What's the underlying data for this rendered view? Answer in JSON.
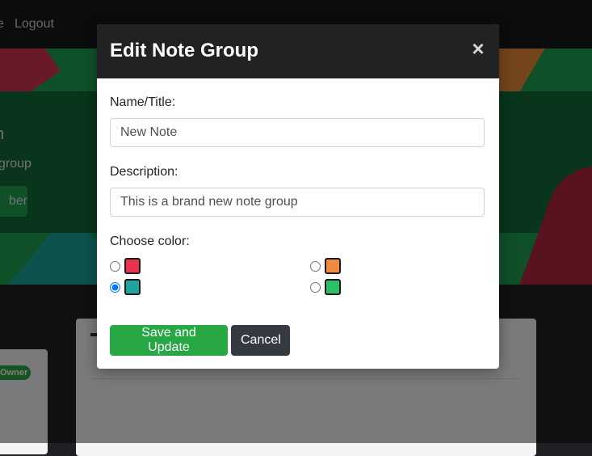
{
  "navbar": {
    "partial_link": "e",
    "logout_label": "Logout"
  },
  "hero": {
    "title_fragment": "n",
    "group_text": "group",
    "button_text": "ber"
  },
  "owner_badge": "Owner",
  "modal": {
    "title": "Edit Note Group",
    "close_glyph": "×",
    "name_label": "Name/Title:",
    "name_value": "New Note",
    "description_label": "Description:",
    "description_value": "This is a brand new note group",
    "color_label": "Choose color:",
    "colors": [
      {
        "name": "red",
        "hex": "#e8344f",
        "selected": false
      },
      {
        "name": "orange",
        "hex": "#f08a3e",
        "selected": false
      },
      {
        "name": "teal",
        "hex": "#1fa39a",
        "selected": true
      },
      {
        "name": "green",
        "hex": "#2bbf68",
        "selected": false
      }
    ],
    "save_label": "Save and Update",
    "cancel_label": "Cancel"
  },
  "theme": {
    "success": "#28a745",
    "dark": "#343a40",
    "header_bg": "#212224"
  }
}
